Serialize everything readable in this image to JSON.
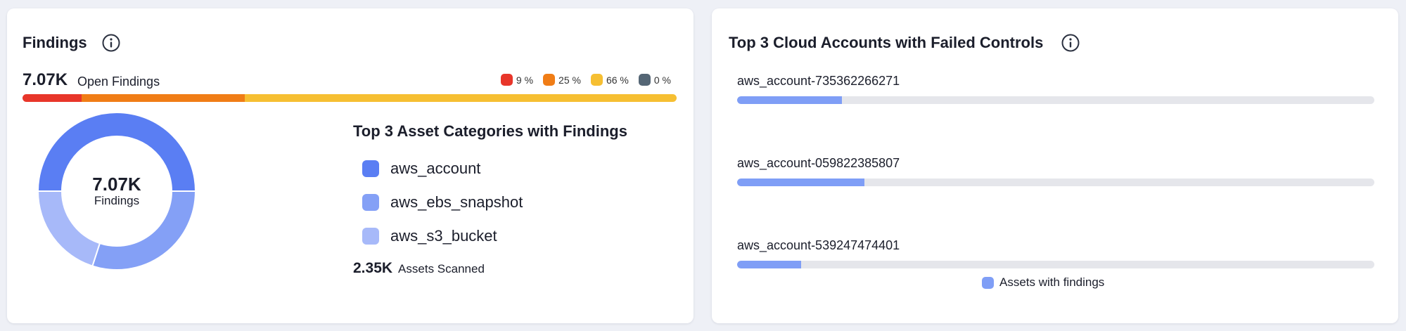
{
  "findings_card": {
    "title": "Findings",
    "open_total": "7.07K",
    "open_label": "Open Findings",
    "severity": [
      {
        "label": "9 %",
        "percent": 9,
        "color": "#e8362a"
      },
      {
        "label": "25 %",
        "percent": 25,
        "color": "#f07d16"
      },
      {
        "label": "66 %",
        "percent": 66,
        "color": "#f6bf32"
      },
      {
        "label": "0 %",
        "percent": 0,
        "color": "#556675"
      }
    ],
    "donut": {
      "value": "7.07K",
      "label": "Findings",
      "slices": [
        {
          "category": "aws_account",
          "percent": 50,
          "color": "#5a7ef3"
        },
        {
          "category": "aws_ebs_snapshot",
          "percent": 30,
          "color": "#84a0f6"
        },
        {
          "category": "aws_s3_bucket",
          "percent": 20,
          "color": "#a7b9f9"
        }
      ]
    },
    "categories_title": "Top 3 Asset Categories with Findings",
    "categories": [
      {
        "label": "aws_account",
        "color": "#5a7ef3"
      },
      {
        "label": "aws_ebs_snapshot",
        "color": "#84a0f6"
      },
      {
        "label": "aws_s3_bucket",
        "color": "#a7b9f9"
      }
    ],
    "assets_value": "2.35K",
    "assets_label": "Assets Scanned"
  },
  "accounts_card": {
    "title": "Top 3 Cloud Accounts with Failed Controls",
    "accounts": [
      {
        "name": "aws_account-735362266271",
        "fraction": 0.165
      },
      {
        "name": "aws_account-059822385807",
        "fraction": 0.2
      },
      {
        "name": "aws_account-539247474401",
        "fraction": 0.1
      }
    ],
    "legend_label": "Assets with findings",
    "legend_color": "#7f9ef6"
  }
}
